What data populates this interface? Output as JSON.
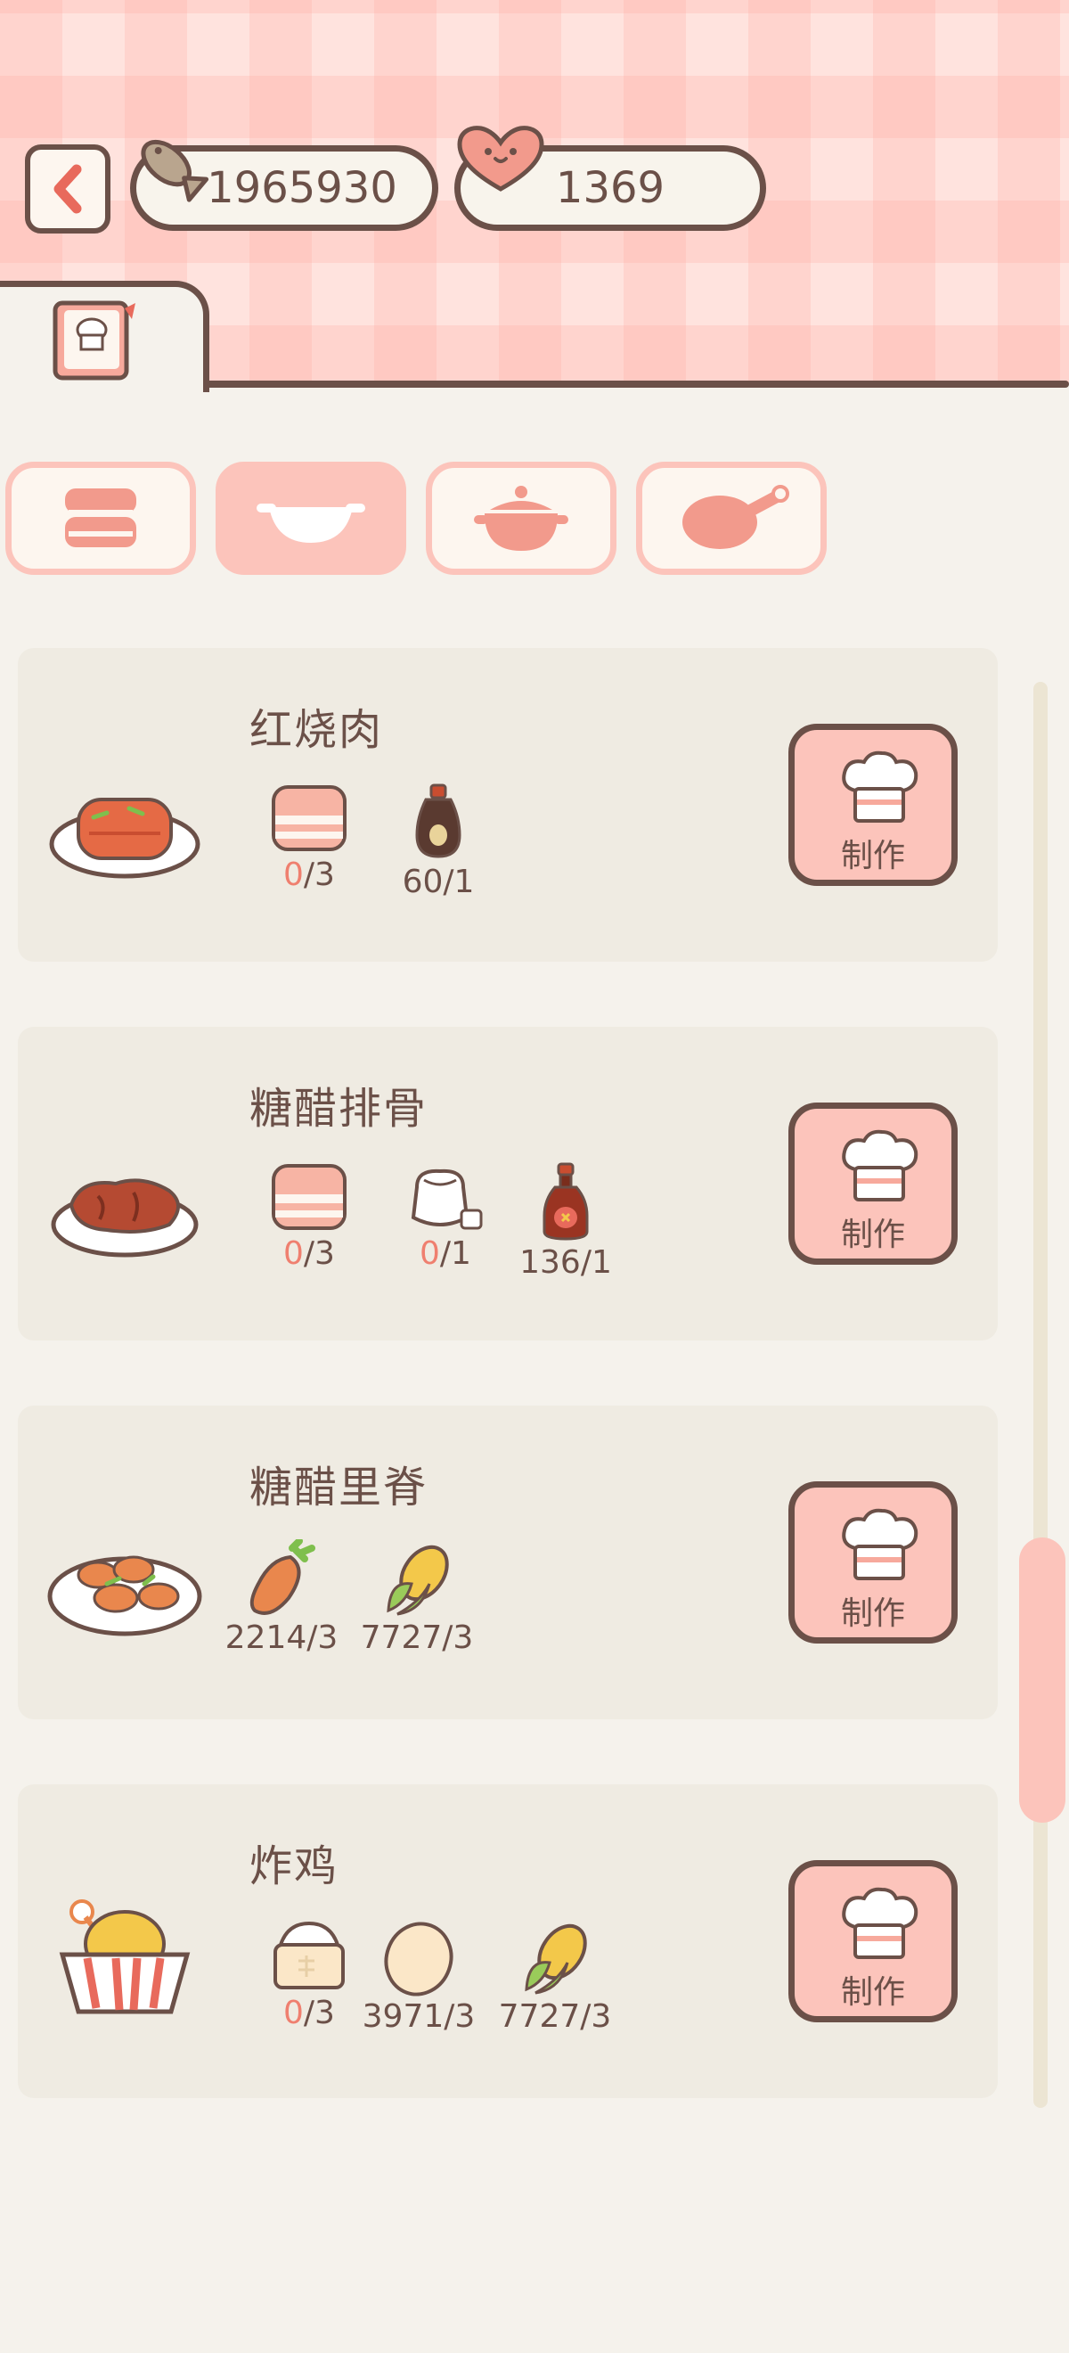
{
  "header": {
    "coins": "1965930",
    "hearts": "1369"
  },
  "colors": {
    "accent": "#fcc4bb",
    "outline": "#6b5048",
    "lacking": "#ef7f6f",
    "card": "#efebe2"
  },
  "categories": [
    {
      "icon": "steamer-icon",
      "active": false
    },
    {
      "icon": "wok-icon",
      "active": true
    },
    {
      "icon": "clay-pot-icon",
      "active": false
    },
    {
      "icon": "frying-pan-icon",
      "active": false
    }
  ],
  "recipes": [
    {
      "name": "红烧肉",
      "dish_icon": "braised-pork-icon",
      "make_label": "制作",
      "ingredients": [
        {
          "icon": "pork-belly-icon",
          "have": "0",
          "need": "/3",
          "lacking": true
        },
        {
          "icon": "soy-sauce-icon",
          "have": "60",
          "need": "/1",
          "lacking": false
        }
      ]
    },
    {
      "name": "糖醋排骨",
      "dish_icon": "sweet-sour-ribs-icon",
      "make_label": "制作",
      "ingredients": [
        {
          "icon": "pork-belly-icon",
          "have": "0",
          "need": "/3",
          "lacking": true
        },
        {
          "icon": "sugar-icon",
          "have": "0",
          "need": "/1",
          "lacking": true
        },
        {
          "icon": "vinegar-icon",
          "have": "136",
          "need": "/1",
          "lacking": false
        }
      ]
    },
    {
      "name": "糖醋里脊",
      "dish_icon": "sweet-sour-tenderloin-icon",
      "make_label": "制作",
      "ingredients": [
        {
          "icon": "carrot-icon",
          "have": "2214",
          "need": "/3",
          "lacking": false
        },
        {
          "icon": "corn-icon",
          "have": "7727",
          "need": "/3",
          "lacking": false
        }
      ]
    },
    {
      "name": "炸鸡",
      "dish_icon": "fried-chicken-icon",
      "make_label": "制作",
      "ingredients": [
        {
          "icon": "flour-icon",
          "have": "0",
          "need": "/3",
          "lacking": true
        },
        {
          "icon": "egg-icon",
          "have": "3971",
          "need": "/3",
          "lacking": false
        },
        {
          "icon": "corn-icon",
          "have": "7727",
          "need": "/3",
          "lacking": false
        }
      ]
    }
  ]
}
